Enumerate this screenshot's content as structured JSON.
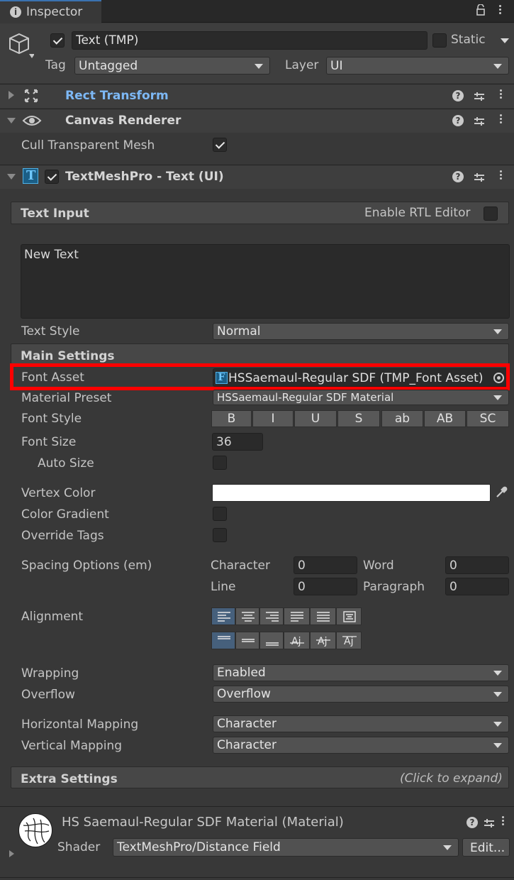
{
  "tab": {
    "title": "Inspector"
  },
  "object": {
    "name": "Text (TMP)",
    "active": true,
    "static_label": "Static",
    "tag_label": "Tag",
    "tag_value": "Untagged",
    "layer_label": "Layer",
    "layer_value": "UI"
  },
  "components": {
    "rect_transform": {
      "title": "Rect Transform"
    },
    "canvas_renderer": {
      "title": "Canvas Renderer",
      "cull_label": "Cull Transparent Mesh",
      "cull_checked": true
    },
    "textmeshpro": {
      "title": "TextMeshPro - Text (UI)",
      "icon_letter": "T"
    }
  },
  "text_input": {
    "header": "Text Input",
    "rtl_label": "Enable RTL Editor",
    "value": "New Text",
    "style_label": "Text Style",
    "style_value": "Normal"
  },
  "main_settings": {
    "header": "Main Settings",
    "font_asset_label": "Font Asset",
    "font_asset_icon": "F",
    "font_asset_value": "HSSaemaul-Regular SDF (TMP_Font Asset)",
    "material_preset_label": "Material Preset",
    "material_preset_value": "HSSaemaul-Regular SDF Material",
    "font_style_label": "Font Style",
    "font_style_buttons": [
      "B",
      "I",
      "U",
      "S",
      "ab",
      "AB",
      "SC"
    ],
    "font_size_label": "Font Size",
    "font_size_value": "36",
    "auto_size_label": "Auto Size",
    "vertex_color_label": "Vertex Color",
    "vertex_color": "#ffffff",
    "color_gradient_label": "Color Gradient",
    "override_tags_label": "Override Tags",
    "spacing_label": "Spacing Options (em)",
    "character_label": "Character",
    "character_value": "0",
    "word_label": "Word",
    "word_value": "0",
    "line_label": "Line",
    "line_value": "0",
    "paragraph_label": "Paragraph",
    "paragraph_value": "0",
    "alignment_label": "Alignment",
    "wrapping_label": "Wrapping",
    "wrapping_value": "Enabled",
    "overflow_label": "Overflow",
    "overflow_value": "Overflow",
    "hmap_label": "Horizontal Mapping",
    "hmap_value": "Character",
    "vmap_label": "Vertical Mapping",
    "vmap_value": "Character"
  },
  "extra_settings": {
    "header": "Extra Settings",
    "hint": "(Click to expand)"
  },
  "material": {
    "title": "HS Saemaul-Regular SDF Material (Material)",
    "shader_label": "Shader",
    "shader_value": "TextMeshPro/Distance Field",
    "edit_label": "Edit..."
  },
  "colors": {
    "highlight": "#ff0000",
    "link": "#7db8f5",
    "selected": "#46607c"
  }
}
